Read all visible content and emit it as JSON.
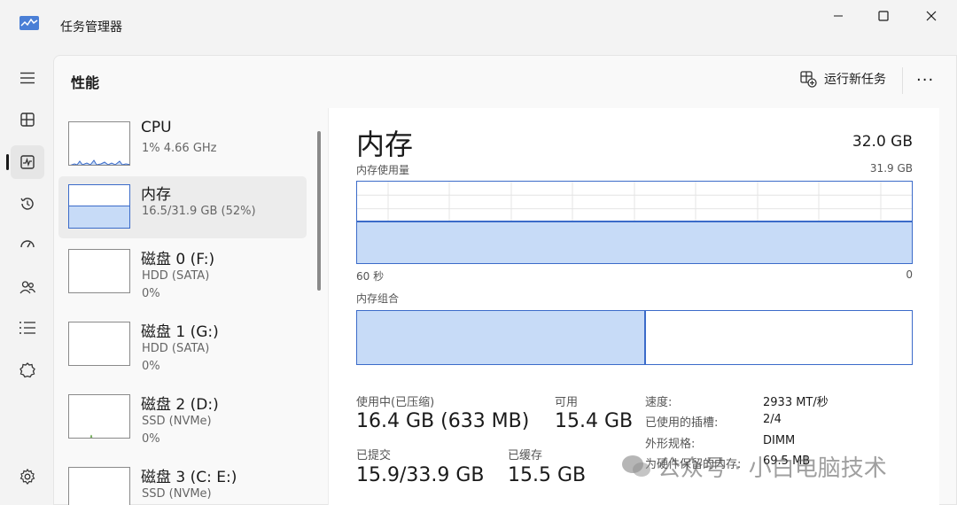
{
  "app": {
    "title": "任务管理器"
  },
  "header": {
    "title": "性能",
    "run_task": "运行新任务",
    "more": "···"
  },
  "nav": [
    {
      "name": "hamburger-icon"
    },
    {
      "name": "processes-icon"
    },
    {
      "name": "performance-icon",
      "active": true
    },
    {
      "name": "app-history-icon"
    },
    {
      "name": "startup-apps-icon"
    },
    {
      "name": "users-icon"
    },
    {
      "name": "details-icon"
    },
    {
      "name": "services-icon"
    },
    {
      "name": "settings-icon"
    }
  ],
  "list": [
    {
      "name": "CPU",
      "sub": "1% 4.66 GHz",
      "sub2": "",
      "level": 0.01
    },
    {
      "name": "内存",
      "sub": "16.5/31.9 GB (52%)",
      "sub2": "",
      "level": 0.52
    },
    {
      "name": "磁盘 0 (F:)",
      "sub": "HDD (SATA)",
      "sub2": "0%",
      "level": 0
    },
    {
      "name": "磁盘 1 (G:)",
      "sub": "HDD (SATA)",
      "sub2": "0%",
      "level": 0
    },
    {
      "name": "磁盘 2 (D:)",
      "sub": "SSD (NVMe)",
      "sub2": "0%",
      "level": 0
    },
    {
      "name": "磁盘 3 (C: E:)",
      "sub": "SSD (NVMe)",
      "sub2": "",
      "level": 0
    }
  ],
  "detail": {
    "title": "内存",
    "total": "32.0 GB",
    "usage_label": "内存使用量",
    "usage_max": "31.9 GB",
    "time_left": "60 秒",
    "time_right": "0",
    "usage_level": 0.52,
    "composition_label": "内存组合",
    "composition_used": 0.52,
    "stats": {
      "in_use_label": "使用中(已压缩)",
      "in_use_value": "16.4 GB (633 MB)",
      "available_label": "可用",
      "available_value": "15.4 GB",
      "committed_label": "已提交",
      "committed_value": "15.9/33.9 GB",
      "cached_label": "已缓存",
      "cached_value": "15.5 GB"
    },
    "props": [
      {
        "label": "速度:",
        "value": "2933 MT/秒"
      },
      {
        "label": "已使用的插槽:",
        "value": "2/4"
      },
      {
        "label": "外形规格:",
        "value": "DIMM"
      },
      {
        "label": "为硬件保留的内存:",
        "value": "69.5 MB"
      }
    ]
  },
  "watermark": "公众号 · 小白电脑技术",
  "colors": {
    "accent": "#3b6bc9",
    "fill": "#c7dbf7"
  }
}
